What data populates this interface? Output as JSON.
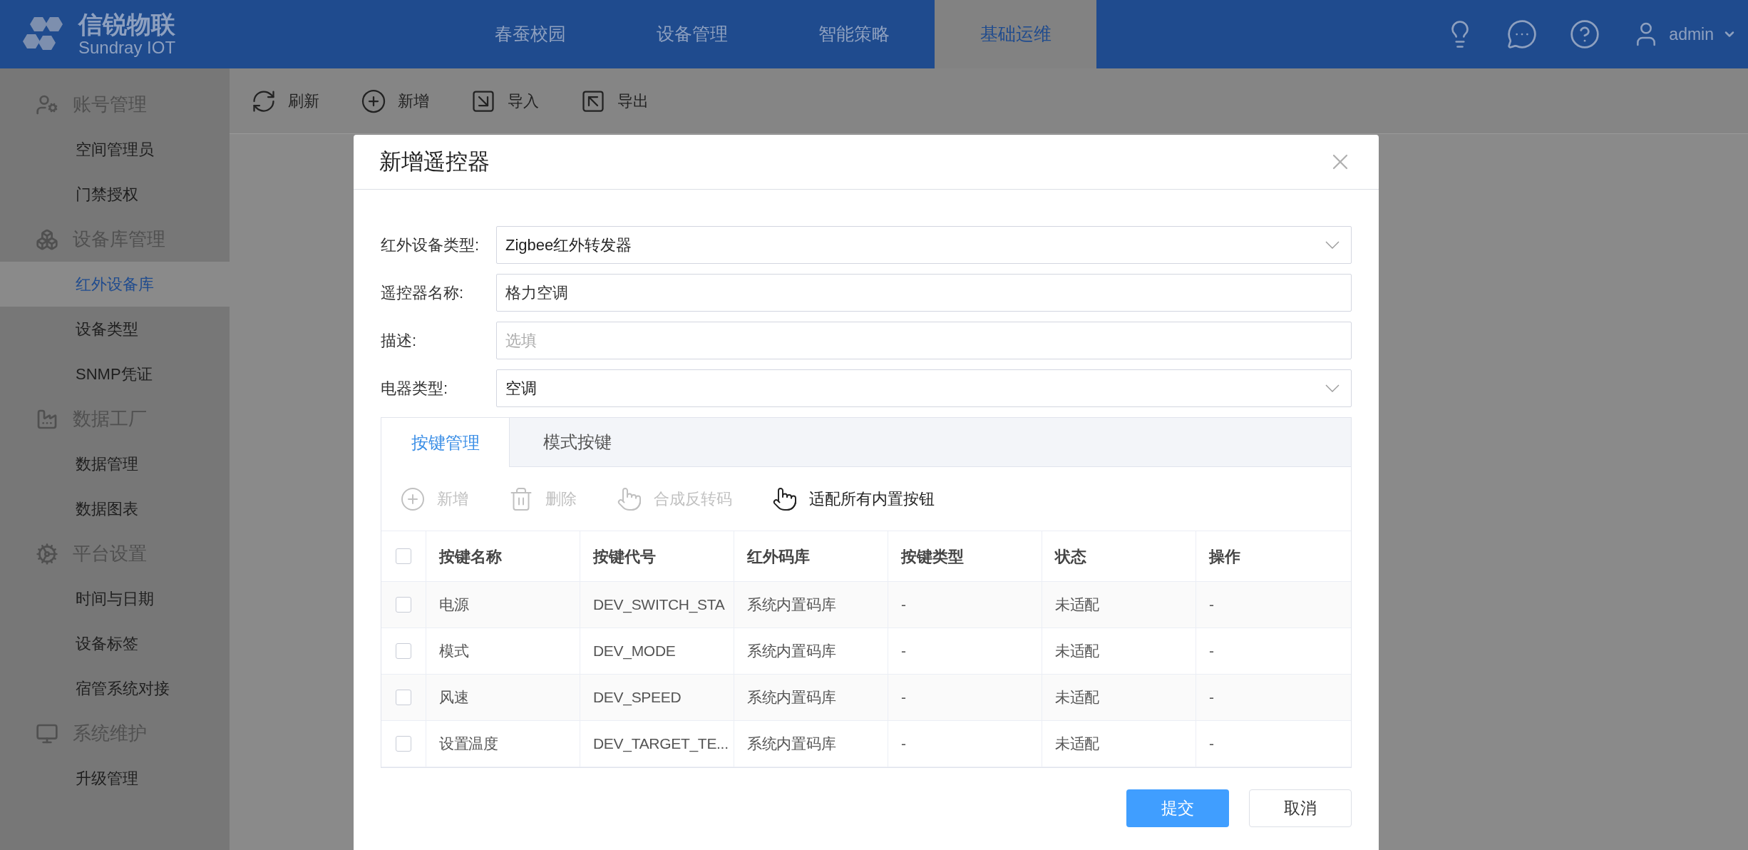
{
  "header": {
    "brand": "信锐物联",
    "brand_sub": "Sundray IOT",
    "nav": [
      {
        "label": "春蚕校园",
        "selected": false
      },
      {
        "label": "设备管理",
        "selected": false
      },
      {
        "label": "智能策略",
        "selected": false
      },
      {
        "label": "基础运维",
        "selected": true
      }
    ],
    "user": "admin"
  },
  "sidebar": {
    "groups": [
      {
        "title": "账号管理",
        "items": [
          {
            "label": "空间管理员",
            "selected": false
          },
          {
            "label": "门禁授权",
            "selected": false
          }
        ]
      },
      {
        "title": "设备库管理",
        "items": [
          {
            "label": "红外设备库",
            "selected": true
          },
          {
            "label": "设备类型",
            "selected": false
          },
          {
            "label": "SNMP凭证",
            "selected": false
          }
        ]
      },
      {
        "title": "数据工厂",
        "items": [
          {
            "label": "数据管理",
            "selected": false
          },
          {
            "label": "数据图表",
            "selected": false
          }
        ]
      },
      {
        "title": "平台设置",
        "items": [
          {
            "label": "时间与日期",
            "selected": false
          },
          {
            "label": "设备标签",
            "selected": false
          },
          {
            "label": "宿管系统对接",
            "selected": false
          }
        ]
      },
      {
        "title": "系统维护",
        "items": [
          {
            "label": "升级管理",
            "selected": false
          }
        ]
      }
    ]
  },
  "toolbar": [
    "刷新",
    "新增",
    "导入",
    "导出"
  ],
  "dialog": {
    "title": "新增遥控器",
    "fields": [
      {
        "kind": "select",
        "label": "红外设备类型:",
        "value": "Zigbee红外转发器"
      },
      {
        "kind": "input",
        "label": "遥控器名称:",
        "value": "格力空调"
      },
      {
        "kind": "input",
        "label": "描述:",
        "placeholder": "选填"
      },
      {
        "kind": "select",
        "label": "电器类型:",
        "value": "空调"
      }
    ],
    "tabs": [
      {
        "label": "按键管理",
        "selected": true
      },
      {
        "label": "模式按键",
        "selected": false
      }
    ],
    "actions": [
      {
        "label": "新增",
        "disabled": true
      },
      {
        "label": "删除",
        "disabled": true
      },
      {
        "label": "合成反转码",
        "disabled": true
      },
      {
        "label": "适配所有内置按钮",
        "disabled": false
      }
    ],
    "table": {
      "select_all_checked": false,
      "columns": [
        "按键名称",
        "按键代号",
        "红外码库",
        "按键类型",
        "状态",
        "操作"
      ],
      "rows": [
        {
          "checked": false,
          "cells": [
            "电源",
            "DEV_SWITCH_STA",
            "系统内置码库",
            "-",
            "未适配",
            "-"
          ]
        },
        {
          "checked": false,
          "cells": [
            "模式",
            "DEV_MODE",
            "系统内置码库",
            "-",
            "未适配",
            "-"
          ]
        },
        {
          "checked": false,
          "cells": [
            "风速",
            "DEV_SPEED",
            "系统内置码库",
            "-",
            "未适配",
            "-"
          ]
        },
        {
          "checked": false,
          "cells": [
            "设置温度",
            "DEV_TARGET_TE...",
            "系统内置码库",
            "-",
            "未适配",
            "-"
          ]
        }
      ]
    },
    "buttons": [
      {
        "kind": "primary",
        "label": "提交"
      },
      {
        "kind": "default",
        "label": "取消"
      }
    ]
  }
}
